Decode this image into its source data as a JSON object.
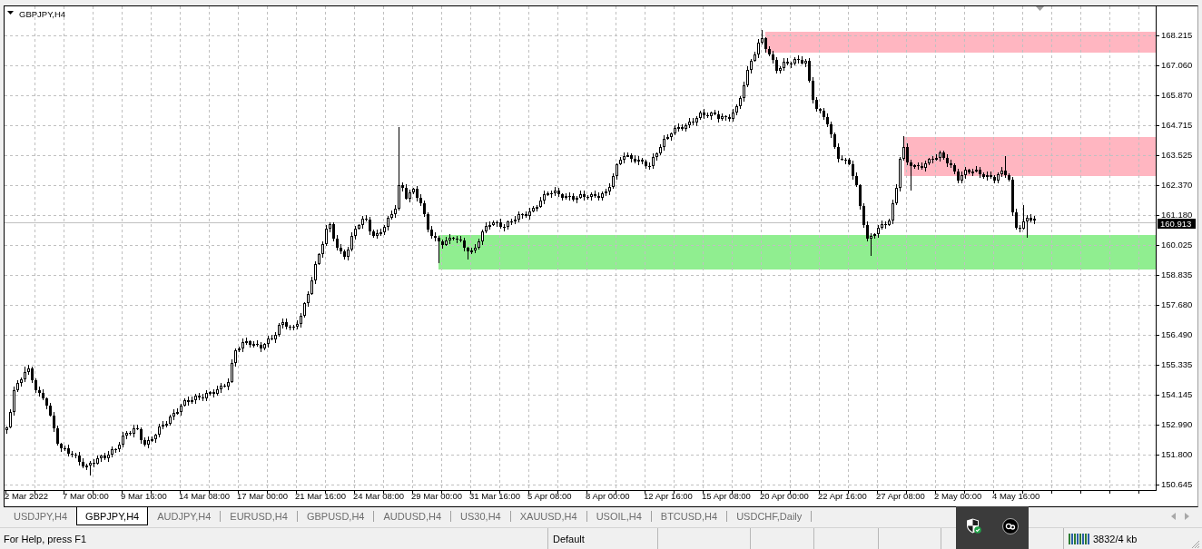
{
  "chart": {
    "title": "GBPJPY,H4",
    "price_labels": [
      "168.215",
      "167.060",
      "165.870",
      "164.715",
      "163.525",
      "162.370",
      "161.180",
      "160.025",
      "158.835",
      "157.680",
      "156.490",
      "155.335",
      "154.145",
      "152.990",
      "151.800",
      "150.645"
    ],
    "current_price": "160.913",
    "time_labels": [
      "2 Mar 2022",
      "7 Mar 00:00",
      "9 Mar 16:00",
      "14 Mar 08:00",
      "17 Mar 00:00",
      "21 Mar 16:00",
      "24 Mar 08:00",
      "29 Mar 00:00",
      "31 Mar 16:00",
      "5 Apr 08:00",
      "8 Apr 00:00",
      "12 Apr 16:00",
      "15 Apr 08:00",
      "20 Apr 00:00",
      "22 Apr 16:00",
      "27 Apr 08:00",
      "2 May 00:00",
      "4 May 16:00"
    ]
  },
  "tabs": [
    {
      "label": "USDJPY,H4",
      "selected": false
    },
    {
      "label": "GBPJPY,H4",
      "selected": true
    },
    {
      "label": "AUDJPY,H4",
      "selected": false
    },
    {
      "label": "EURUSD,H4",
      "selected": false
    },
    {
      "label": "GBPUSD,H4",
      "selected": false
    },
    {
      "label": "AUDUSD,H4",
      "selected": false
    },
    {
      "label": "US30,H4",
      "selected": false
    },
    {
      "label": "XAUUSD,H4",
      "selected": false
    },
    {
      "label": "USOIL,H4",
      "selected": false
    },
    {
      "label": "BTCUSD,H4",
      "selected": false
    },
    {
      "label": "USDCHF,Daily",
      "selected": false
    }
  ],
  "status_bar": {
    "help_text": "For Help, press F1",
    "profile": "Default",
    "traffic": "3832/4 kb"
  }
}
